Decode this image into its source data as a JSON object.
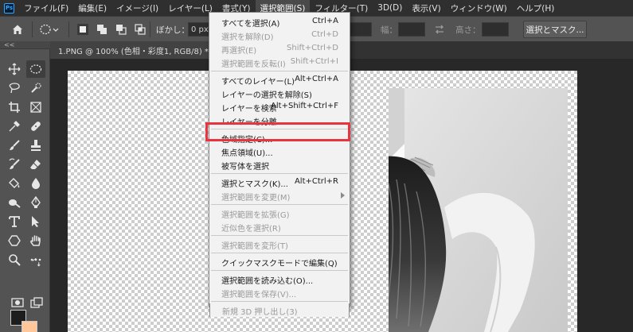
{
  "app": {
    "logo": "Ps"
  },
  "menubar": {
    "items": [
      "ファイル(F)",
      "編集(E)",
      "イメージ(I)",
      "レイヤー(L)",
      "書式(Y)",
      "選択範囲(S)",
      "フィルター(T)",
      "3D(D)",
      "表示(V)",
      "ウィンドウ(W)",
      "ヘルプ(H)"
    ],
    "active_index": 5
  },
  "options": {
    "feather_label": "ぼかし：",
    "feather_value": "0 px",
    "width_label": "幅：",
    "height_label": "高さ：",
    "select_mask_button": "選択とマスク..."
  },
  "toolbar": {
    "header": "<<",
    "icons": [
      "move-icon",
      "marquee-icon",
      "lasso-icon",
      "quick-select-icon",
      "crop-icon",
      "frame-icon",
      "eyedropper-icon",
      "healing-icon",
      "brush-icon",
      "stamp-icon",
      "history-brush-icon",
      "eraser-icon",
      "bucket-icon",
      "blur-icon",
      "dodge-icon",
      "pen-icon",
      "type-icon",
      "path-select-icon",
      "shape-icon",
      "hand-icon",
      "zoom-icon",
      "more-icon",
      "quickmask-icon",
      "screen-mode-icon"
    ],
    "foreground_color": "#1d1d1d",
    "background_color": "#ffc79a"
  },
  "document": {
    "tab_title": "1.PNG @ 100% (色相・彩度1, RGB/8) *",
    "close_symbol": "×"
  },
  "dropdown": {
    "items": [
      {
        "label": "すべてを選択(A)",
        "shortcut": "Ctrl+A",
        "disabled": false
      },
      {
        "label": "選択を解除(D)",
        "shortcut": "Ctrl+D",
        "disabled": true
      },
      {
        "label": "再選択(E)",
        "shortcut": "Shift+Ctrl+D",
        "disabled": true
      },
      {
        "label": "選択範囲を反転(I)",
        "shortcut": "Shift+Ctrl+I",
        "disabled": true
      },
      {
        "label": "すべてのレイヤー(L)",
        "shortcut": "Alt+Ctrl+A",
        "disabled": false
      },
      {
        "label": "レイヤーの選択を解除(S)",
        "shortcut": "",
        "disabled": false
      },
      {
        "label": "レイヤーを検索",
        "shortcut": "Alt+Shift+Ctrl+F",
        "disabled": false
      },
      {
        "label": "レイヤーを分離",
        "shortcut": "",
        "disabled": false
      },
      {
        "label": "色域指定(C)...",
        "shortcut": "",
        "disabled": false
      },
      {
        "label": "焦点領域(U)...",
        "shortcut": "",
        "disabled": false
      },
      {
        "label": "被写体を選択",
        "shortcut": "",
        "disabled": false
      },
      {
        "label": "選択とマスク(K)...",
        "shortcut": "Alt+Ctrl+R",
        "disabled": false
      },
      {
        "label": "選択範囲を変更(M)",
        "shortcut": "",
        "disabled": true
      },
      {
        "label": "選択範囲を拡張(G)",
        "shortcut": "",
        "disabled": true
      },
      {
        "label": "近似色を選択(R)",
        "shortcut": "",
        "disabled": true
      },
      {
        "label": "選択範囲を変形(T)",
        "shortcut": "",
        "disabled": true
      },
      {
        "label": "クイックマスクモードで編集(Q)",
        "shortcut": "",
        "disabled": false
      },
      {
        "label": "選択範囲を読み込む(O)...",
        "shortcut": "",
        "disabled": false
      },
      {
        "label": "選択範囲を保存(V)...",
        "shortcut": "",
        "disabled": true
      },
      {
        "label": "新規 3D 押し出し(3)",
        "shortcut": "",
        "disabled": true
      }
    ],
    "highlighted_index": 8,
    "highlight_color": "#e8343f"
  }
}
